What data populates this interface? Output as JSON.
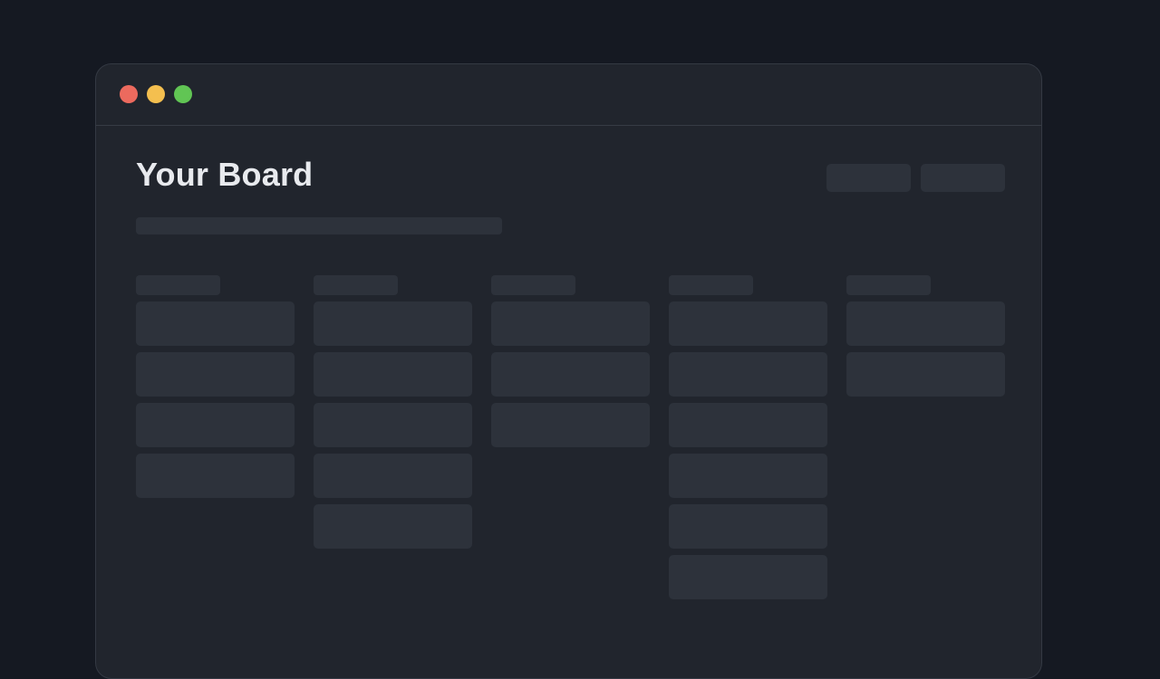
{
  "window": {
    "controls": [
      {
        "name": "close",
        "color": "#ec6a5e"
      },
      {
        "name": "minimize",
        "color": "#f4bf4f"
      },
      {
        "name": "zoom",
        "color": "#61c554"
      }
    ]
  },
  "board": {
    "title": "Your Board",
    "header_buttons": [
      {
        "label": ""
      },
      {
        "label": ""
      }
    ],
    "subtitle": "",
    "columns": [
      {
        "header": "",
        "cards": [
          "",
          "",
          "",
          ""
        ]
      },
      {
        "header": "",
        "cards": [
          "",
          "",
          "",
          "",
          ""
        ]
      },
      {
        "header": "",
        "cards": [
          "",
          "",
          ""
        ]
      },
      {
        "header": "",
        "cards": [
          "",
          "",
          "",
          "",
          "",
          ""
        ]
      },
      {
        "header": "",
        "cards": [
          "",
          ""
        ]
      }
    ]
  }
}
